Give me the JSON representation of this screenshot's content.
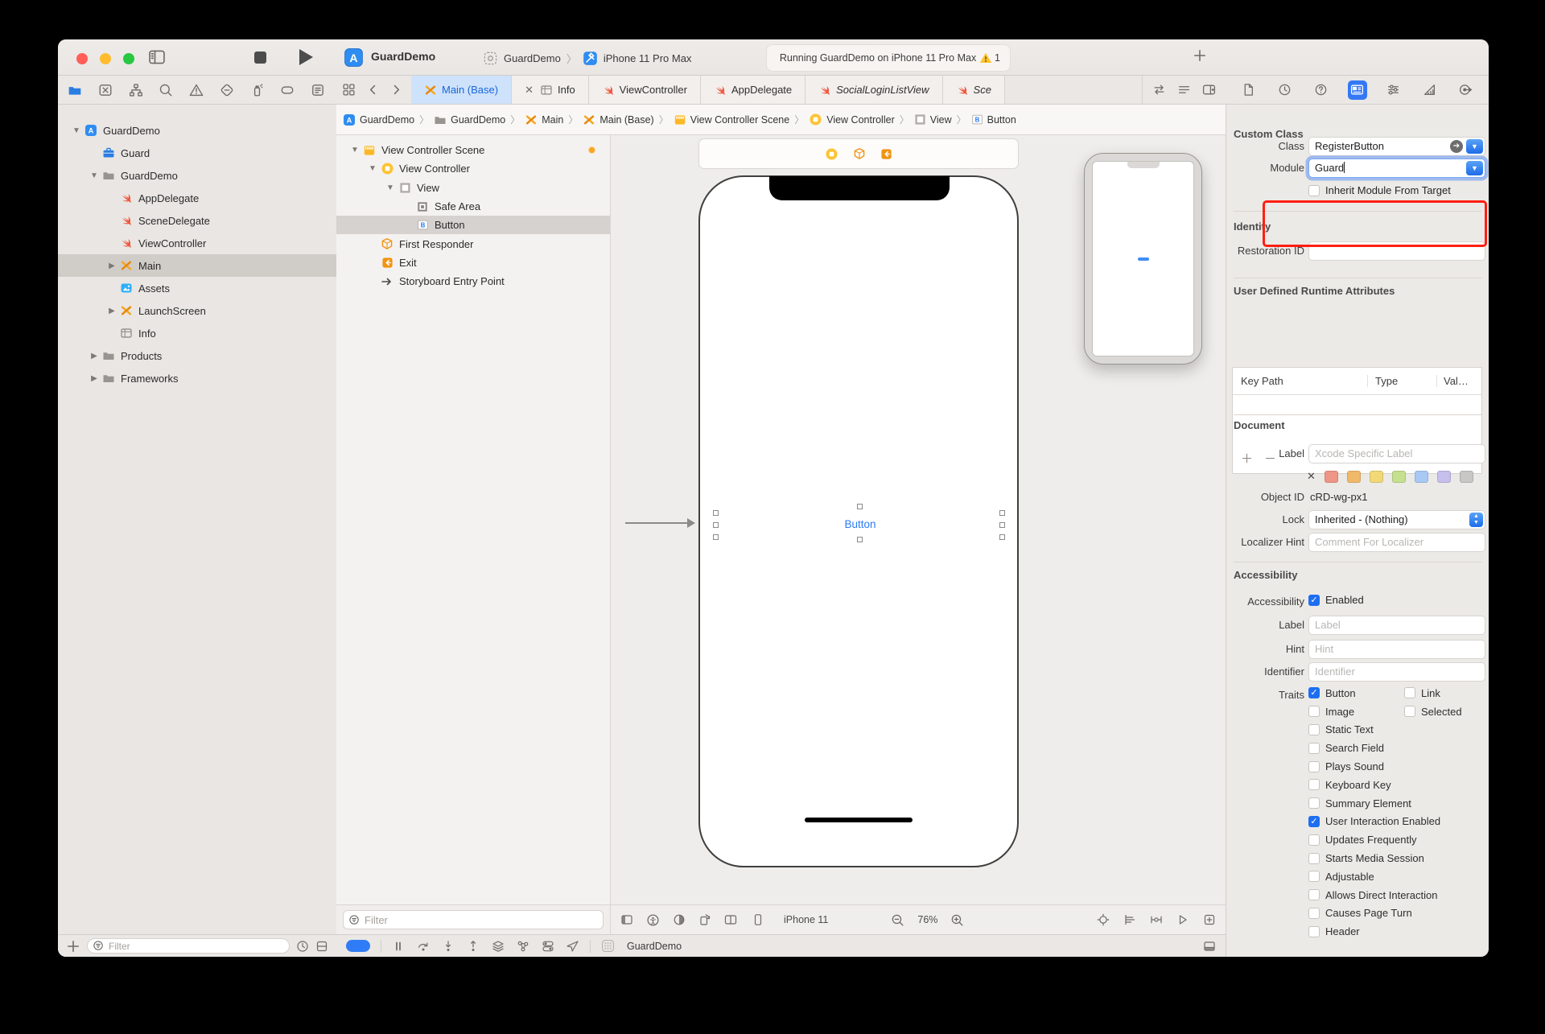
{
  "window": {
    "controls": [
      "close",
      "minimize",
      "zoom"
    ],
    "traffic_colors": {
      "close": "#ff5f57",
      "minimize": "#febc2e",
      "zoom": "#28c840"
    }
  },
  "toolbar": {
    "app_title": "GuardDemo",
    "scheme_project": "GuardDemo",
    "scheme_device": "iPhone 11 Pro Max",
    "status_text": "Running GuardDemo on iPhone 11 Pro Max",
    "warning_count": "1"
  },
  "navigator_bar_icons": [
    "project-navigator-icon",
    "source-control-icon",
    "symbol-navigator-icon",
    "find-navigator-icon",
    "issue-navigator-icon",
    "test-navigator-icon",
    "debug-navigator-icon",
    "breakpoint-navigator-icon",
    "report-navigator-icon"
  ],
  "navigator": {
    "rows": [
      {
        "label": "GuardDemo",
        "icon": "app",
        "depth": 0,
        "chevron": "open"
      },
      {
        "label": "Guard",
        "icon": "briefcase",
        "depth": 1
      },
      {
        "label": "GuardDemo",
        "icon": "folder",
        "depth": 1,
        "chevron": "open"
      },
      {
        "label": "AppDelegate",
        "icon": "swift",
        "depth": 2
      },
      {
        "label": "SceneDelegate",
        "icon": "swift",
        "depth": 2
      },
      {
        "label": "ViewController",
        "icon": "swift",
        "depth": 2
      },
      {
        "label": "Main",
        "icon": "storyboard",
        "depth": 2,
        "chevron": "closed",
        "selected": true
      },
      {
        "label": "Assets",
        "icon": "assets",
        "depth": 2
      },
      {
        "label": "LaunchScreen",
        "icon": "storyboard",
        "depth": 2,
        "chevron": "closed"
      },
      {
        "label": "Info",
        "icon": "table",
        "depth": 2
      },
      {
        "label": "Products",
        "icon": "folder",
        "depth": 1,
        "chevron": "closed"
      },
      {
        "label": "Frameworks",
        "icon": "folder",
        "depth": 1,
        "chevron": "closed"
      }
    ],
    "filter_placeholder": "Filter"
  },
  "tabs": [
    {
      "label": "Main (Base)",
      "icon": "storyboard",
      "active": true
    },
    {
      "label": "Info",
      "icon": "table",
      "close": true
    },
    {
      "label": "ViewController",
      "icon": "swift"
    },
    {
      "label": "AppDelegate",
      "icon": "swift"
    },
    {
      "label": "SocialLoginListView",
      "icon": "swift",
      "italic": true
    },
    {
      "label": "Sce",
      "icon": "swift",
      "italic": true
    }
  ],
  "breadcrumb": [
    {
      "label": "GuardDemo",
      "icon": "app"
    },
    {
      "label": "GuardDemo",
      "icon": "folder"
    },
    {
      "label": "Main",
      "icon": "storyboard"
    },
    {
      "label": "Main (Base)",
      "icon": "storyboard"
    },
    {
      "label": "View Controller Scene",
      "icon": "scene"
    },
    {
      "label": "View Controller",
      "icon": "vc"
    },
    {
      "label": "View",
      "icon": "view"
    },
    {
      "label": "Button",
      "icon": "buttonB"
    }
  ],
  "outline": {
    "rows": [
      {
        "label": "View Controller Scene",
        "icon": "scene",
        "depth": 0,
        "chevron": "open",
        "dot": true
      },
      {
        "label": "View Controller",
        "icon": "vc",
        "depth": 1,
        "chevron": "open"
      },
      {
        "label": "View",
        "icon": "view",
        "depth": 2,
        "chevron": "open"
      },
      {
        "label": "Safe Area",
        "icon": "safearea",
        "depth": 3
      },
      {
        "label": "Button",
        "icon": "buttonB",
        "depth": 3,
        "selected": true
      },
      {
        "label": "First Responder",
        "icon": "cube",
        "depth": 1
      },
      {
        "label": "Exit",
        "icon": "exit",
        "depth": 1
      },
      {
        "label": "Storyboard Entry Point",
        "icon": "entry",
        "depth": 1
      }
    ],
    "filter_placeholder": "Filter"
  },
  "canvas": {
    "button_label": "Button",
    "device_label": "iPhone 11",
    "zoom_level": "76%",
    "left_icons": [
      "editor-sidebar-icon",
      "accessibility-preview-icon",
      "appearance-icon",
      "orientation-icon",
      "split-view-icon"
    ],
    "right_icons": [
      "update-frames-icon",
      "align-icon",
      "add-constraints-icon",
      "resolve-layout-icon",
      "embed-icon"
    ]
  },
  "debug_bar": {
    "process_name": "GuardDemo",
    "icons": [
      "pause-icon",
      "step-over-icon",
      "step-into-icon",
      "step-out-icon",
      "view-hierarchy-icon",
      "memory-graph-icon",
      "environment-overrides-icon",
      "simulate-location-icon"
    ]
  },
  "inspector": {
    "tab_icons": [
      "file-inspector-icon",
      "history-inspector-icon",
      "quick-help-icon",
      "identity-inspector-icon",
      "attributes-inspector-icon",
      "size-inspector-icon",
      "connections-inspector-icon"
    ],
    "custom_class": {
      "header": "Custom Class",
      "class_label": "Class",
      "class_value": "RegisterButton",
      "module_label": "Module",
      "module_value": "Guard",
      "inherit_label": "Inherit Module From Target",
      "highlight_color": "#ff1e12"
    },
    "identity": {
      "header": "Identity",
      "restoration_label": "Restoration ID"
    },
    "udra": {
      "header": "User Defined Runtime Attributes",
      "col_keypath": "Key Path",
      "col_type": "Type",
      "col_value": "Val…"
    },
    "document": {
      "header": "Document",
      "label_label": "Label",
      "label_placeholder": "Xcode Specific Label",
      "object_id_label": "Object ID",
      "object_id_value": "cRD-wg-px1",
      "lock_label": "Lock",
      "lock_value": "Inherited - (Nothing)",
      "localizer_label": "Localizer Hint",
      "localizer_placeholder": "Comment For Localizer",
      "colors": [
        "#ee9586",
        "#efb96a",
        "#f2d876",
        "#c5e08e",
        "#a8c9f4",
        "#c6bfec",
        "#c9c7c5"
      ]
    },
    "accessibility": {
      "header": "Accessibility",
      "acc_label": "Accessibility",
      "enabled_label": "Enabled",
      "label_label": "Label",
      "label_placeholder": "Label",
      "hint_label": "Hint",
      "hint_placeholder": "Hint",
      "identifier_label": "Identifier",
      "identifier_placeholder": "Identifier",
      "traits_label": "Traits",
      "trait_rows": [
        [
          {
            "label": "Button",
            "checked": true
          },
          {
            "label": "Link",
            "checked": false
          }
        ],
        [
          {
            "label": "Image",
            "checked": false
          },
          {
            "label": "Selected",
            "checked": false
          }
        ],
        [
          {
            "label": "Static Text",
            "checked": false
          }
        ],
        [
          {
            "label": "Search Field",
            "checked": false
          }
        ],
        [
          {
            "label": "Plays Sound",
            "checked": false
          }
        ],
        [
          {
            "label": "Keyboard Key",
            "checked": false
          }
        ],
        [
          {
            "label": "Summary Element",
            "checked": false
          }
        ],
        [
          {
            "label": "User Interaction Enabled",
            "checked": true
          }
        ],
        [
          {
            "label": "Updates Frequently",
            "checked": false
          }
        ],
        [
          {
            "label": "Starts Media Session",
            "checked": false
          }
        ],
        [
          {
            "label": "Adjustable",
            "checked": false
          }
        ],
        [
          {
            "label": "Allows Direct Interaction",
            "checked": false
          }
        ],
        [
          {
            "label": "Causes Page Turn",
            "checked": false
          }
        ],
        [
          {
            "label": "Header",
            "checked": false
          }
        ]
      ]
    }
  }
}
